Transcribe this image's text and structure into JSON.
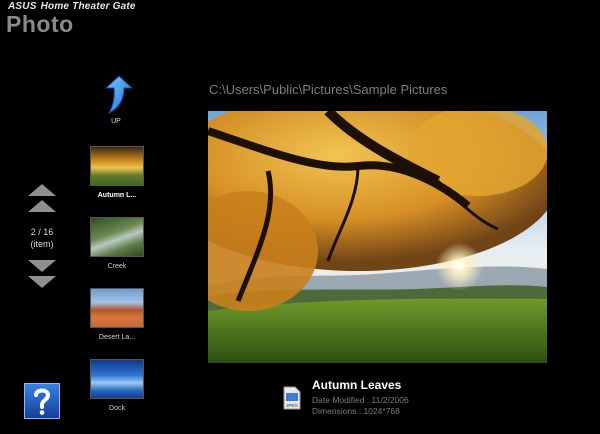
{
  "app": {
    "brand": "ASUS",
    "brand_product": "Home Theater Gate",
    "title": "Photo"
  },
  "nav": {
    "up_label": "UP",
    "counter_line1": "2 / 16",
    "counter_line2": "(item)"
  },
  "thumbnails": [
    {
      "label": "Autumn L...",
      "selected": true
    },
    {
      "label": "Creek",
      "selected": false
    },
    {
      "label": "Desert La...",
      "selected": false
    },
    {
      "label": "Dock",
      "selected": false
    }
  ],
  "path": "C:\\Users\\Public\\Pictures\\Sample Pictures",
  "info": {
    "name": "Autumn Leaves",
    "date_modified": "Date Modified : 11/2/2006",
    "dimensions": "Dimensions : 1024*768",
    "file_type": "JPEG"
  },
  "colors": {
    "background": "#000000",
    "title": "#8a8a8a",
    "path": "#7d7d7d",
    "up_arrow": "#2b8fe0",
    "help_button": "#1f5fc2"
  }
}
